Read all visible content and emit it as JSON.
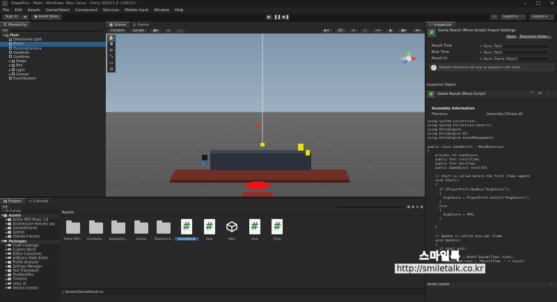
{
  "window": {
    "title": "StageRun - Main - Windows, Mac, Linux - Unity 2023.1.0 <DX11>"
  },
  "menu": [
    "File",
    "Edit",
    "Assets",
    "GameObject",
    "Component",
    "Services",
    "Mobile Input",
    "Window",
    "Help"
  ],
  "toolbar": {
    "sign_in": "Sign In",
    "asset_store": "Asset Store",
    "layers": "Layers",
    "layout": "Layout"
  },
  "hierarchy": {
    "tab": "Hierarchy",
    "items": [
      {
        "label": "Main",
        "depth": 0,
        "style": "bold"
      },
      {
        "label": "Directional Light",
        "depth": 1,
        "style": ""
      },
      {
        "label": "Player",
        "depth": 1,
        "style": "blue"
      },
      {
        "label": "TrackingCamera",
        "depth": 1,
        "style": "blue"
      },
      {
        "label": "GoalArea",
        "depth": 1,
        "style": ""
      },
      {
        "label": "GoalArea",
        "depth": 1,
        "style": ""
      },
      {
        "label": "Stage",
        "depth": 1,
        "style": ""
      },
      {
        "label": "Box",
        "depth": 1,
        "style": ""
      },
      {
        "label": "Light",
        "depth": 1,
        "style": ""
      },
      {
        "label": "Canvas",
        "depth": 1,
        "style": ""
      },
      {
        "label": "EventSystem",
        "depth": 1,
        "style": ""
      }
    ]
  },
  "scene": {
    "tabs": [
      "Scene",
      "Game"
    ],
    "pivot": "Center",
    "space": "Local",
    "mode_2d": "2D"
  },
  "inspector": {
    "tab": "Inspector",
    "header": "Game Result (Mono Script) Import Settings",
    "open_btn": "Open",
    "exec_btn": "Execution Order...",
    "fields": [
      {
        "label": "Result Time",
        "value": "None (Text)"
      },
      {
        "label": "Best Time",
        "value": "None (Text)"
      },
      {
        "label": "Result UI",
        "value": "None (Game Object)"
      }
    ],
    "info_note": "Default references will only be applied in edit mode.",
    "imported_object": "Imported Object",
    "imported_title": "Game Result (Mono Script)",
    "assembly_title": "Assembly Information",
    "filename_label": "Filename",
    "filename_value": "Assembly-CSharp.dll",
    "asset_labels": "Asset Labels",
    "code": "using System.Collections;\nusing System.Collections.Generic;\nusing UnityEngine;\nusing UnityEngine.UI;\nusing UnityEngine.SceneManagement;\n\npublic class GameResult : MonoBehaviour\n{\n    private int highScore;\n    public Text resultTime;\n    public Text bestTime;\n    public GameObject resultUI;\n\n    // Start is called before the first frame update\n    void Start()\n    {\n      if (PlayerPrefs.HasKey(\"HighScore\"))\n      {\n        highScore = PlayerPrefs.GetInt(\"HighScore\");\n      }\n      else\n      {\n        highScore = 999;\n      }\n\n    }\n\n    // Update is called once per frame\n    void Update()\n    {\n      if (Goal.goal)\n      {\n        int Timer = Mathf.Round(Timer.time);\n        resultTime.text = \"ResultTime: \" + result;\n"
  },
  "project": {
    "tabs": [
      "Project",
      "Console"
    ],
    "favorites": "All Prefabs",
    "tree": [
      {
        "label": "Assets",
        "bold": true,
        "depth": 0
      },
      {
        "label": "Action RPG Music 1.6",
        "depth": 1
      },
      {
        "label": "Architecture textures pac",
        "depth": 1
      },
      {
        "label": "SampleScenes",
        "depth": 1
      },
      {
        "label": "Scenes",
        "depth": 1
      },
      {
        "label": "Standard Assets",
        "depth": 1
      },
      {
        "label": "Packages",
        "bold": true,
        "depth": 0
      },
      {
        "label": "Code Coverage",
        "depth": 1
      },
      {
        "label": "Custom NUnit",
        "depth": 1
      },
      {
        "label": "Editor Coroutines",
        "depth": 1
      },
      {
        "label": "JetBrains Rider Editor",
        "depth": 1
      },
      {
        "label": "Profile Analyzer",
        "depth": 1
      },
      {
        "label": "Settings Manager",
        "depth": 1
      },
      {
        "label": "Test Framework",
        "depth": 1
      },
      {
        "label": "TextMeshPro",
        "depth": 1
      },
      {
        "label": "Timeline",
        "depth": 1
      },
      {
        "label": "Unity UI",
        "depth": 1
      },
      {
        "label": "Version Control",
        "depth": 1
      }
    ],
    "breadcrumb": "Assets",
    "assets": [
      {
        "label": "Action RPG...",
        "type": "folder"
      },
      {
        "label": "Architectu...",
        "type": "folder"
      },
      {
        "label": "SampleSce...",
        "type": "folder"
      },
      {
        "label": "Scenes",
        "type": "folder"
      },
      {
        "label": "Standard A...",
        "type": "folder"
      },
      {
        "label": "GameResult",
        "type": "script",
        "selected": true
      },
      {
        "label": "Goal",
        "type": "script"
      },
      {
        "label": "Main",
        "type": "unity"
      },
      {
        "label": "Goal",
        "type": "script"
      },
      {
        "label": "Timer",
        "type": "script"
      }
    ],
    "path": "Assets/GameResult.cs"
  },
  "watermark": {
    "line1": "스마일톡",
    "line2": "http://smiletalk.co.kr"
  }
}
